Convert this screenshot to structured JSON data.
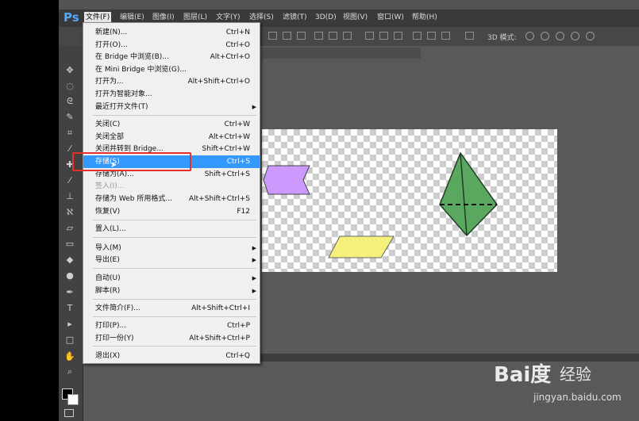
{
  "app": {
    "logo": "Ps"
  },
  "menubar": [
    {
      "label": "文件(F)",
      "active": true
    },
    {
      "label": "编辑(E)"
    },
    {
      "label": "图像(I)"
    },
    {
      "label": "图层(L)"
    },
    {
      "label": "文字(Y)"
    },
    {
      "label": "选择(S)"
    },
    {
      "label": "滤镜(T)"
    },
    {
      "label": "3D(D)"
    },
    {
      "label": "视图(V)"
    },
    {
      "label": "窗口(W)"
    },
    {
      "label": "帮助(H)"
    }
  ],
  "options_bar": {
    "mode_3d_label": "3D 模式:"
  },
  "file_menu": {
    "items": [
      {
        "label": "新建(N)...",
        "shortcut": "Ctrl+N"
      },
      {
        "label": "打开(O)...",
        "shortcut": "Ctrl+O"
      },
      {
        "label": "在 Bridge 中浏览(B)...",
        "shortcut": "Alt+Ctrl+O"
      },
      {
        "label": "在 Mini Bridge 中浏览(G)...",
        "shortcut": ""
      },
      {
        "label": "打开为...",
        "shortcut": "Alt+Shift+Ctrl+O"
      },
      {
        "label": "打开为智能对象...",
        "shortcut": ""
      },
      {
        "label": "最近打开文件(T)",
        "shortcut": "",
        "submenu": true
      },
      {
        "label": "关闭(C)",
        "shortcut": "Ctrl+W"
      },
      {
        "label": "关闭全部",
        "shortcut": "Alt+Ctrl+W"
      },
      {
        "label": "关闭并转到 Bridge...",
        "shortcut": "Shift+Ctrl+W"
      },
      {
        "label": "存储(S)",
        "shortcut": "Ctrl+S",
        "highlighted": true
      },
      {
        "label": "存储为(A)...",
        "shortcut": "Shift+Ctrl+S"
      },
      {
        "label": "签入(I)...",
        "shortcut": "",
        "disabled": true
      },
      {
        "label": "存储为 Web 所用格式...",
        "shortcut": "Alt+Shift+Ctrl+S"
      },
      {
        "label": "恢复(V)",
        "shortcut": "F12"
      },
      {
        "label": "置入(L)...",
        "shortcut": ""
      },
      {
        "label": "导入(M)",
        "shortcut": "",
        "submenu": true
      },
      {
        "label": "导出(E)",
        "shortcut": "",
        "submenu": true
      },
      {
        "label": "自动(U)",
        "shortcut": "",
        "submenu": true
      },
      {
        "label": "脚本(R)",
        "shortcut": "",
        "submenu": true
      },
      {
        "label": "文件简介(F)...",
        "shortcut": "Alt+Shift+Ctrl+I"
      },
      {
        "label": "打印(P)...",
        "shortcut": "Ctrl+P"
      },
      {
        "label": "打印一份(Y)",
        "shortcut": "Alt+Shift+Ctrl+P"
      },
      {
        "label": "退出(X)",
        "shortcut": "Ctrl+Q"
      }
    ]
  },
  "canvas": {
    "shapes": [
      {
        "name": "purple-arrow-shape",
        "color": "#cc99ff"
      },
      {
        "name": "green-pyramid-shape",
        "color": "#5aa860"
      },
      {
        "name": "yellow-parallelogram-shape",
        "color": "#f4f07a"
      }
    ]
  },
  "watermark": {
    "brand": "Bai度",
    "sub": "经验",
    "url": "jingyan.baidu.com"
  },
  "colors": {
    "highlight": "#3399ff",
    "annotation_red": "#e8302a",
    "ps_blue": "#53a9ff"
  }
}
